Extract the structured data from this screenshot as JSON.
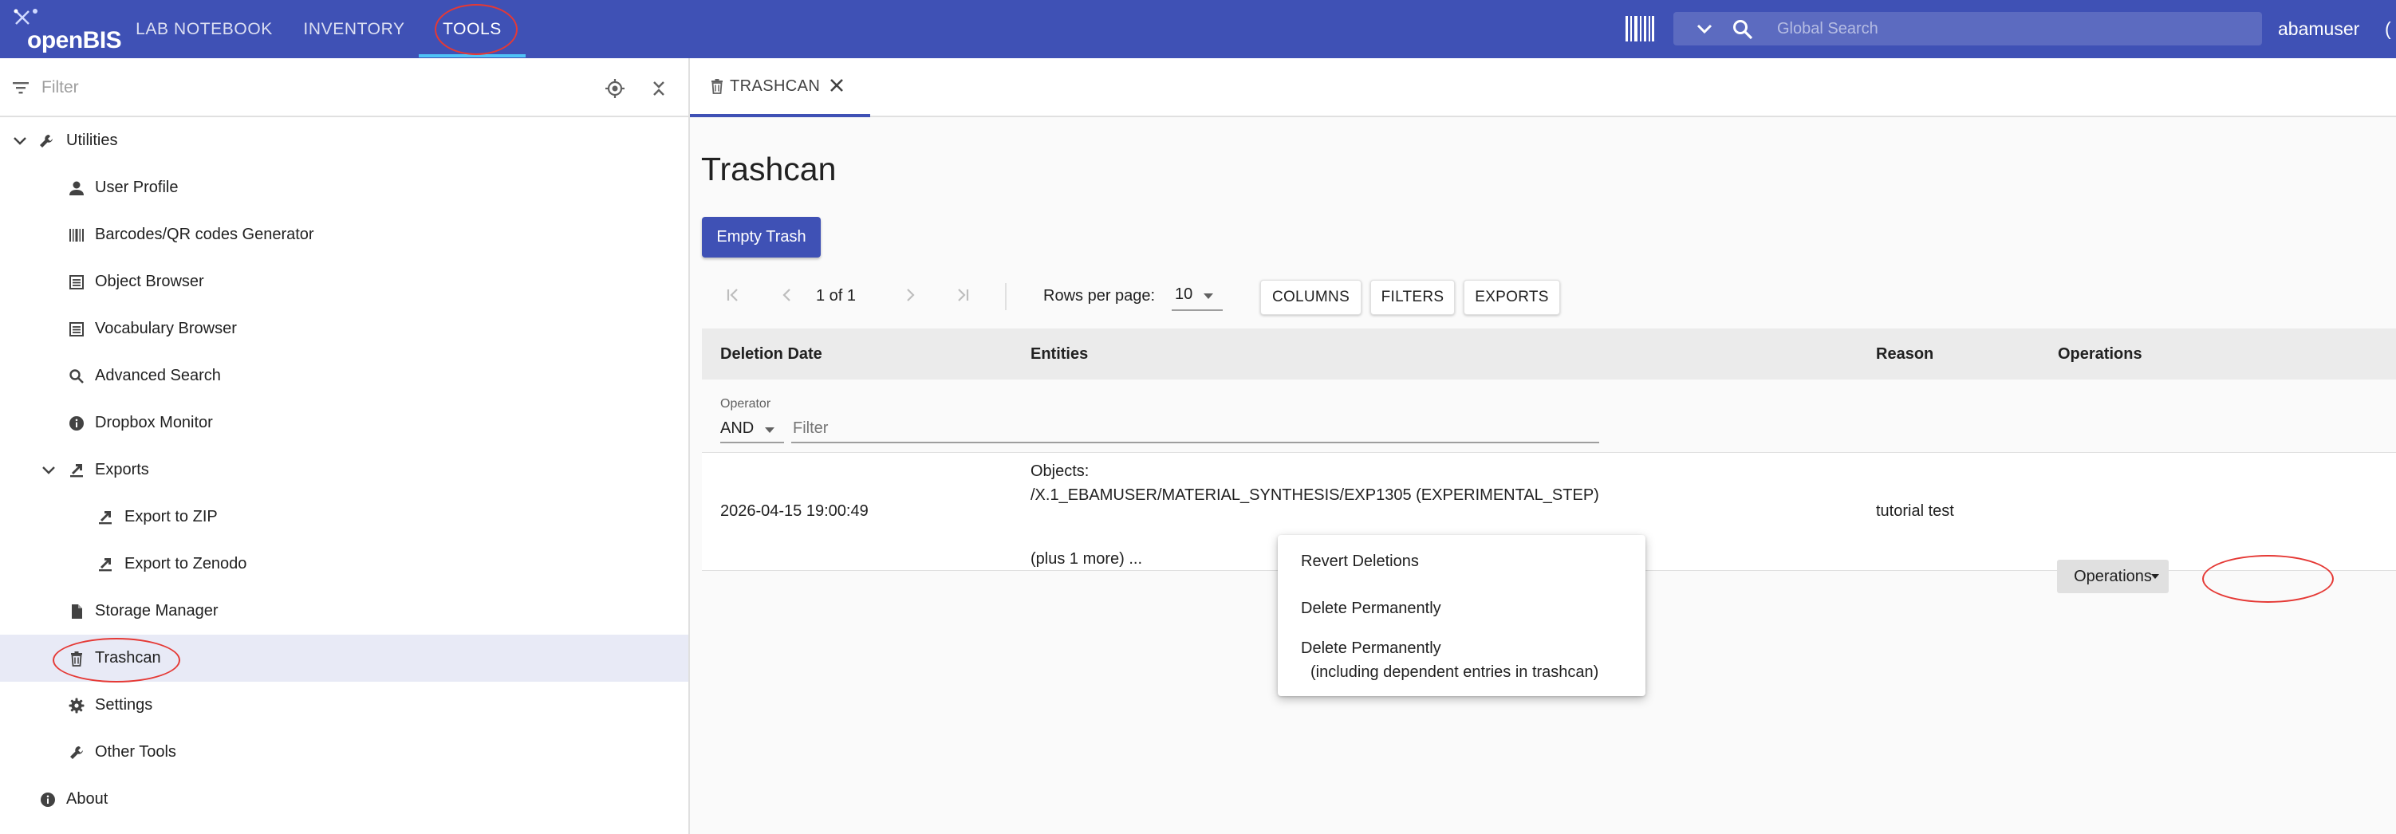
{
  "app": {
    "logo_text": "openBIS"
  },
  "nav": {
    "items": [
      "LAB NOTEBOOK",
      "INVENTORY",
      "TOOLS"
    ],
    "active": "TOOLS"
  },
  "search": {
    "placeholder": "Global Search"
  },
  "user": {
    "name": "abamuser"
  },
  "sidebar": {
    "filter_placeholder": "Filter",
    "tree": {
      "utilities": "Utilities",
      "user_profile": "User Profile",
      "barcodes": "Barcodes/QR codes Generator",
      "object_browser": "Object Browser",
      "vocabulary_browser": "Vocabulary Browser",
      "advanced_search": "Advanced Search",
      "dropbox_monitor": "Dropbox Monitor",
      "exports": "Exports",
      "export_zip": "Export to ZIP",
      "export_zenodo": "Export to Zenodo",
      "storage_manager": "Storage Manager",
      "trashcan": "Trashcan",
      "settings": "Settings",
      "other_tools": "Other Tools",
      "about": "About"
    },
    "selected": "Trashcan"
  },
  "tab": {
    "label": "TRASHCAN"
  },
  "page": {
    "title": "Trashcan",
    "empty_button": "Empty Trash"
  },
  "pager": {
    "page_text": "1 of 1",
    "rows_per_page_label": "Rows per page:",
    "rows_per_page_value": "10",
    "columns_button": "COLUMNS",
    "filters_button": "FILTERS",
    "exports_button": "EXPORTS"
  },
  "grid": {
    "columns": [
      "Deletion Date",
      "Entities",
      "Reason",
      "Operations"
    ],
    "operator_label": "Operator",
    "operator_value": "AND",
    "filter_placeholder": "Filter",
    "rows": [
      {
        "deletion_date": "2026-04-15 19:00:49",
        "entities_heading": "Objects:",
        "entities_path": "/X.1_EBAMUSER/MATERIAL_SYNTHESIS/EXP1305 (EXPERIMENTAL_STEP)",
        "entities_more": "(plus 1 more) ...",
        "reason": "tutorial test",
        "operations_label": "Operations"
      }
    ]
  },
  "operations_menu": {
    "items": [
      "Revert Deletions",
      "Delete Permanently",
      "Delete Permanently",
      "(including dependent entries in trashcan)"
    ]
  },
  "colors": {
    "topbar": "#3f51b5",
    "accent_underline": "#4fc3f7",
    "highlight_circle": "#e53935",
    "selected_row": "#e8eaf6"
  }
}
